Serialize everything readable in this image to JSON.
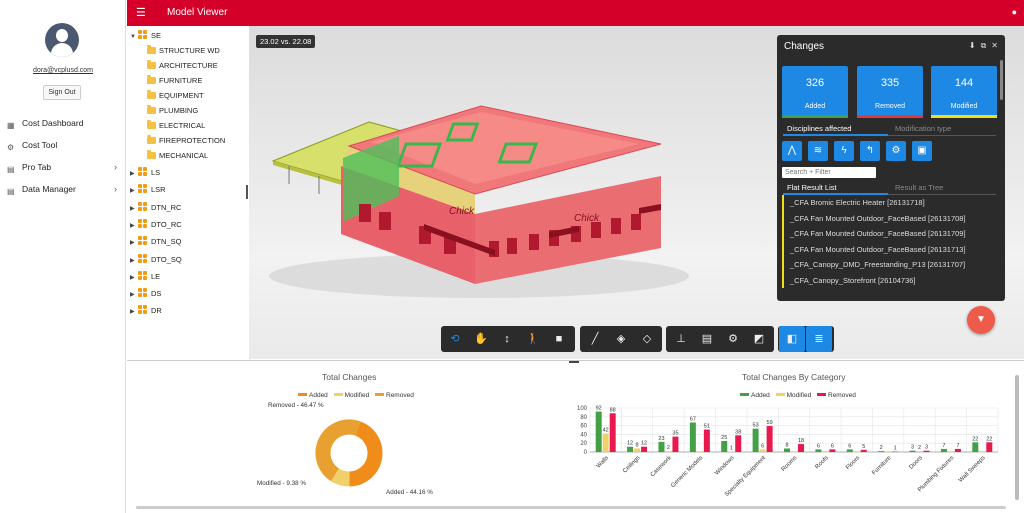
{
  "sidebar": {
    "email": "dora@vcplusd.com",
    "signout_label": "Sign Out",
    "nav": [
      {
        "label": "Cost Dashboard",
        "icon": "table-icon",
        "glyph": "▦",
        "chevron": ""
      },
      {
        "label": "Cost Tool",
        "icon": "gear-icon",
        "glyph": "⚙",
        "chevron": ""
      },
      {
        "label": "Pro Tab",
        "icon": "grid-icon",
        "glyph": "▤",
        "chevron": "›"
      },
      {
        "label": "Data Manager",
        "icon": "database-icon",
        "glyph": "▤",
        "chevron": "›"
      }
    ]
  },
  "header": {
    "title": "Model Viewer",
    "menu_glyph": "☰",
    "bell_glyph": "🔔"
  },
  "tree": {
    "root": "SE",
    "children": [
      "STRUCTURE WD",
      "ARCHITECTURE",
      "FURNITURE",
      "EQUIPMENT",
      "PLUMBING",
      "ELECTRICAL",
      "FIREPROTECTION",
      "MECHANICAL"
    ],
    "siblings": [
      "LS",
      "LSR",
      "DTN_RC",
      "DTO_RC",
      "DTN_SQ",
      "DTO_SQ",
      "LE",
      "DS",
      "DR"
    ]
  },
  "viewer": {
    "version_label": "23.02 vs. 22.08"
  },
  "changes": {
    "title": "Changes",
    "stats": [
      {
        "value": "326",
        "label": "Added",
        "color": "#43a047"
      },
      {
        "value": "335",
        "label": "Removed",
        "color": "#e53935"
      },
      {
        "value": "144",
        "label": "Modified",
        "color": "#f0e01a"
      }
    ],
    "tab_disciplines": "Disciplines affected",
    "tab_modification": "Modification type",
    "filter_placeholder": "Search + Filter",
    "tab_flat": "Flat Result List",
    "tab_tree": "Result as Tree",
    "results": [
      "_CFA Bromic Electric Heater [26131718]",
      "_CFA Fan Mounted Outdoor_FaceBased [26131708]",
      "_CFA Fan Mounted Outdoor_FaceBased [26131709]",
      "_CFA Fan Mounted Outdoor_FaceBased [26131713]",
      "_CFA_Canopy_DMD_Freestanding_P13 [26131707]",
      "_CFA_Canopy_Storefront [26104736]"
    ]
  },
  "chart_data": [
    {
      "type": "pie",
      "title": "Total Changes",
      "legend": [
        "Added",
        "Modified",
        "Removed"
      ],
      "legend_placement": "top",
      "colors": [
        "#f08c1a",
        "#f0d06a",
        "#e8a030"
      ],
      "slices": [
        {
          "name": "Added",
          "label": "Added - 44.16 %",
          "value": 44.16
        },
        {
          "name": "Modified",
          "label": "Modified - 9.38 %",
          "value": 9.38
        },
        {
          "name": "Removed",
          "label": "Removed - 46.47 %",
          "value": 46.47
        }
      ]
    },
    {
      "type": "bar",
      "title": "Total Changes By Category",
      "legend": [
        "Added",
        "Modified",
        "Removed"
      ],
      "legend_placement": "top",
      "colors": [
        "#43a047",
        "#f0d06a",
        "#e8194f"
      ],
      "ylim": [
        0,
        100
      ],
      "yticks": [
        0,
        20,
        40,
        60,
        80,
        100
      ],
      "categories": [
        "Walls",
        "Ceilings",
        "Casework",
        "Generic Models",
        "Windows",
        "Specialty Equipment",
        "Rooms",
        "Roofs",
        "Floors",
        "Furniture",
        "Doors",
        "Plumbing Fixtures",
        "Wall Sweeps"
      ],
      "series": [
        {
          "name": "Added",
          "values": [
            92,
            12,
            23,
            67,
            25,
            53,
            8,
            6,
            6,
            2,
            3,
            7,
            22
          ]
        },
        {
          "name": "Modified",
          "values": [
            42,
            8,
            2,
            0,
            1,
            6,
            0,
            0,
            0,
            0,
            2,
            0,
            0
          ]
        },
        {
          "name": "Removed",
          "values": [
            88,
            12,
            35,
            51,
            38,
            59,
            18,
            6,
            5,
            1,
            3,
            7,
            22
          ]
        }
      ]
    }
  ]
}
